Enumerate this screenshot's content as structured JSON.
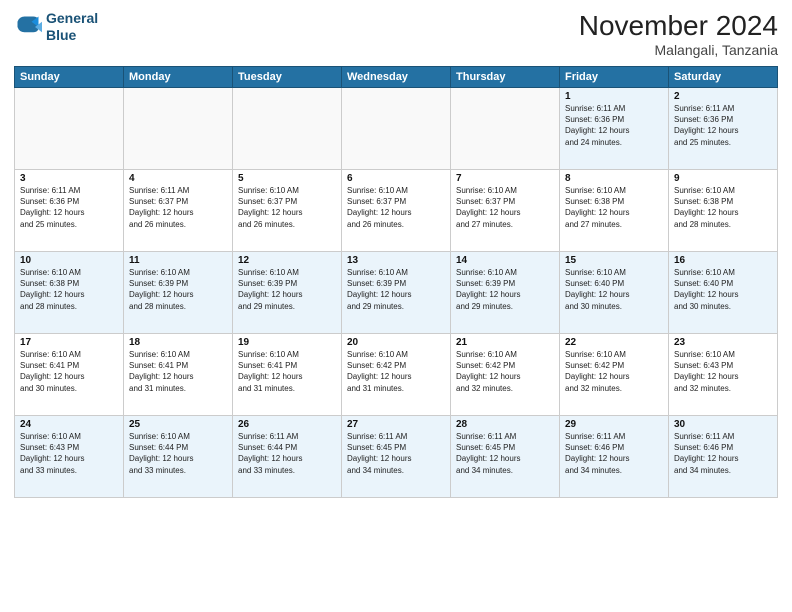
{
  "header": {
    "logo_line1": "General",
    "logo_line2": "Blue",
    "month": "November 2024",
    "location": "Malangali, Tanzania"
  },
  "weekdays": [
    "Sunday",
    "Monday",
    "Tuesday",
    "Wednesday",
    "Thursday",
    "Friday",
    "Saturday"
  ],
  "weeks": [
    [
      {
        "day": "",
        "info": ""
      },
      {
        "day": "",
        "info": ""
      },
      {
        "day": "",
        "info": ""
      },
      {
        "day": "",
        "info": ""
      },
      {
        "day": "",
        "info": ""
      },
      {
        "day": "1",
        "info": "Sunrise: 6:11 AM\nSunset: 6:36 PM\nDaylight: 12 hours\nand 24 minutes."
      },
      {
        "day": "2",
        "info": "Sunrise: 6:11 AM\nSunset: 6:36 PM\nDaylight: 12 hours\nand 25 minutes."
      }
    ],
    [
      {
        "day": "3",
        "info": "Sunrise: 6:11 AM\nSunset: 6:36 PM\nDaylight: 12 hours\nand 25 minutes."
      },
      {
        "day": "4",
        "info": "Sunrise: 6:11 AM\nSunset: 6:37 PM\nDaylight: 12 hours\nand 26 minutes."
      },
      {
        "day": "5",
        "info": "Sunrise: 6:10 AM\nSunset: 6:37 PM\nDaylight: 12 hours\nand 26 minutes."
      },
      {
        "day": "6",
        "info": "Sunrise: 6:10 AM\nSunset: 6:37 PM\nDaylight: 12 hours\nand 26 minutes."
      },
      {
        "day": "7",
        "info": "Sunrise: 6:10 AM\nSunset: 6:37 PM\nDaylight: 12 hours\nand 27 minutes."
      },
      {
        "day": "8",
        "info": "Sunrise: 6:10 AM\nSunset: 6:38 PM\nDaylight: 12 hours\nand 27 minutes."
      },
      {
        "day": "9",
        "info": "Sunrise: 6:10 AM\nSunset: 6:38 PM\nDaylight: 12 hours\nand 28 minutes."
      }
    ],
    [
      {
        "day": "10",
        "info": "Sunrise: 6:10 AM\nSunset: 6:38 PM\nDaylight: 12 hours\nand 28 minutes."
      },
      {
        "day": "11",
        "info": "Sunrise: 6:10 AM\nSunset: 6:39 PM\nDaylight: 12 hours\nand 28 minutes."
      },
      {
        "day": "12",
        "info": "Sunrise: 6:10 AM\nSunset: 6:39 PM\nDaylight: 12 hours\nand 29 minutes."
      },
      {
        "day": "13",
        "info": "Sunrise: 6:10 AM\nSunset: 6:39 PM\nDaylight: 12 hours\nand 29 minutes."
      },
      {
        "day": "14",
        "info": "Sunrise: 6:10 AM\nSunset: 6:39 PM\nDaylight: 12 hours\nand 29 minutes."
      },
      {
        "day": "15",
        "info": "Sunrise: 6:10 AM\nSunset: 6:40 PM\nDaylight: 12 hours\nand 30 minutes."
      },
      {
        "day": "16",
        "info": "Sunrise: 6:10 AM\nSunset: 6:40 PM\nDaylight: 12 hours\nand 30 minutes."
      }
    ],
    [
      {
        "day": "17",
        "info": "Sunrise: 6:10 AM\nSunset: 6:41 PM\nDaylight: 12 hours\nand 30 minutes."
      },
      {
        "day": "18",
        "info": "Sunrise: 6:10 AM\nSunset: 6:41 PM\nDaylight: 12 hours\nand 31 minutes."
      },
      {
        "day": "19",
        "info": "Sunrise: 6:10 AM\nSunset: 6:41 PM\nDaylight: 12 hours\nand 31 minutes."
      },
      {
        "day": "20",
        "info": "Sunrise: 6:10 AM\nSunset: 6:42 PM\nDaylight: 12 hours\nand 31 minutes."
      },
      {
        "day": "21",
        "info": "Sunrise: 6:10 AM\nSunset: 6:42 PM\nDaylight: 12 hours\nand 32 minutes."
      },
      {
        "day": "22",
        "info": "Sunrise: 6:10 AM\nSunset: 6:42 PM\nDaylight: 12 hours\nand 32 minutes."
      },
      {
        "day": "23",
        "info": "Sunrise: 6:10 AM\nSunset: 6:43 PM\nDaylight: 12 hours\nand 32 minutes."
      }
    ],
    [
      {
        "day": "24",
        "info": "Sunrise: 6:10 AM\nSunset: 6:43 PM\nDaylight: 12 hours\nand 33 minutes."
      },
      {
        "day": "25",
        "info": "Sunrise: 6:10 AM\nSunset: 6:44 PM\nDaylight: 12 hours\nand 33 minutes."
      },
      {
        "day": "26",
        "info": "Sunrise: 6:11 AM\nSunset: 6:44 PM\nDaylight: 12 hours\nand 33 minutes."
      },
      {
        "day": "27",
        "info": "Sunrise: 6:11 AM\nSunset: 6:45 PM\nDaylight: 12 hours\nand 34 minutes."
      },
      {
        "day": "28",
        "info": "Sunrise: 6:11 AM\nSunset: 6:45 PM\nDaylight: 12 hours\nand 34 minutes."
      },
      {
        "day": "29",
        "info": "Sunrise: 6:11 AM\nSunset: 6:46 PM\nDaylight: 12 hours\nand 34 minutes."
      },
      {
        "day": "30",
        "info": "Sunrise: 6:11 AM\nSunset: 6:46 PM\nDaylight: 12 hours\nand 34 minutes."
      }
    ]
  ]
}
